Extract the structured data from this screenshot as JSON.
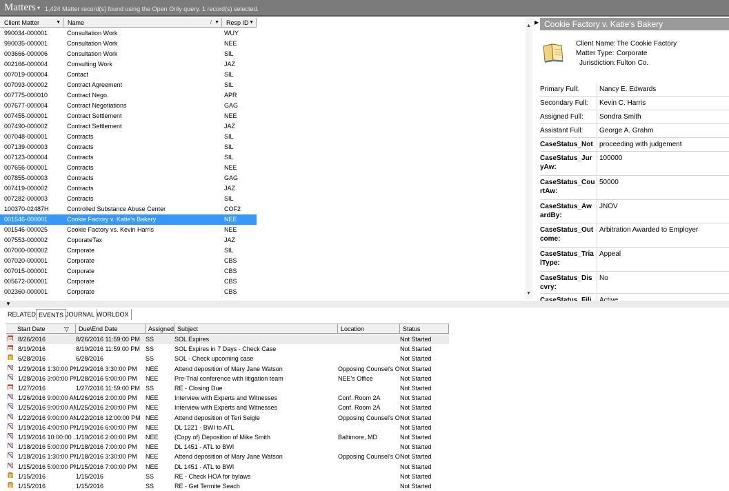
{
  "topbar": {
    "title": "Matters",
    "dropdown": "▾",
    "info": "1,424 Matter record(s) found using the Open Only query.     1 record(s) selected."
  },
  "grid": {
    "columns": [
      "Client Matter",
      "Name",
      "Resp ID"
    ],
    "rows": [
      {
        "cm": "990034-000001",
        "name": "Consultation Work",
        "resp": "WUY"
      },
      {
        "cm": "990035-000001",
        "name": "Consultation Work",
        "resp": "NEE"
      },
      {
        "cm": "003666-000006",
        "name": "Consultation Work",
        "resp": "SIL"
      },
      {
        "cm": "002166-000004",
        "name": "Consulting Work",
        "resp": "JAZ"
      },
      {
        "cm": "007019-000004",
        "name": "Contact",
        "resp": "SIL"
      },
      {
        "cm": "007093-000002",
        "name": "Contract Agreement",
        "resp": "SIL"
      },
      {
        "cm": "007775-000010",
        "name": "Contract Nego.",
        "resp": "APR"
      },
      {
        "cm": "007677-000004",
        "name": "Contract Negotiations",
        "resp": "GAG"
      },
      {
        "cm": "007455-000001",
        "name": "Contract Settlement",
        "resp": "NEE"
      },
      {
        "cm": "007490-000002",
        "name": "Contract Settlement",
        "resp": "JAZ"
      },
      {
        "cm": "007048-000001",
        "name": "Contracts",
        "resp": "SIL"
      },
      {
        "cm": "007139-000003",
        "name": "Contracts",
        "resp": "SIL"
      },
      {
        "cm": "007123-000004",
        "name": "Contracts",
        "resp": "SIL"
      },
      {
        "cm": "007656-000001",
        "name": "Contracts",
        "resp": "NEE"
      },
      {
        "cm": "007855-000003",
        "name": "Contracts",
        "resp": "GAG"
      },
      {
        "cm": "007419-000002",
        "name": "Contracts",
        "resp": "JAZ"
      },
      {
        "cm": "007282-000003",
        "name": "Contracts",
        "resp": "SIL"
      },
      {
        "cm": "100370-02487H",
        "name": "Controlled Substance Abuse Center",
        "resp": "COF2"
      },
      {
        "cm": "001546-000001",
        "name": "Cookie Factory v. Katie's Bakery",
        "resp": "NEE",
        "selected": true
      },
      {
        "cm": "001546-000025",
        "name": "Cookie Factory vs. Kevin Harris",
        "resp": "NEE"
      },
      {
        "cm": "007553-000002",
        "name": "CoporateTax",
        "resp": "JAZ"
      },
      {
        "cm": "007000-000002",
        "name": "Corporate",
        "resp": "SIL"
      },
      {
        "cm": "007020-000001",
        "name": "Corporate",
        "resp": "CBS"
      },
      {
        "cm": "007015-000001",
        "name": "Corporate",
        "resp": "CBS"
      },
      {
        "cm": "005672-000001",
        "name": "Corporate",
        "resp": "CBS"
      },
      {
        "cm": "002360-000001",
        "name": "Corporate",
        "resp": "CBS"
      }
    ]
  },
  "detail": {
    "header": "Cookie Factory v. Katie's Bakery",
    "client_name_label": "Client Name:",
    "client_name": "The Cookie Factory",
    "matter_type_label": "Matter Type:",
    "matter_type": "Corporate",
    "jurisdiction_label": "Jurisdiction:",
    "jurisdiction": "Fulton Co.",
    "fields": [
      {
        "l1": "Primary Full:",
        "l2": "",
        "value": "Nancy E. Edwards",
        "bold": false
      },
      {
        "l1": "Secondary Full:",
        "l2": "",
        "value": "Kevin C. Harris",
        "bold": false
      },
      {
        "l1": "Assigned Full:",
        "l2": "",
        "value": "Sondra Smith",
        "bold": false
      },
      {
        "l1": "Assistant Full:",
        "l2": "",
        "value": "George A. Grahm",
        "bold": false
      },
      {
        "l1": "CaseStatus_Not",
        "l2": "",
        "value": "proceeding with judgement",
        "bold": true
      },
      {
        "l1": "CaseStatus_Jur",
        "l2": "yAw:",
        "value": "100000",
        "bold": true
      },
      {
        "l1": "CaseStatus_Cou",
        "l2": "rtAw:",
        "value": "50000",
        "bold": true
      },
      {
        "l1": "CaseStatus_Aw",
        "l2": "ardBy:",
        "value": "JNOV",
        "bold": true
      },
      {
        "l1": "CaseStatus_Out",
        "l2": "come:",
        "value": "Arbitration Awarded to Employer",
        "bold": true
      },
      {
        "l1": "CaseStatus_Tria",
        "l2": "lType:",
        "value": "Appeal",
        "bold": true
      },
      {
        "l1": "CaseStatus_Dis",
        "l2": "cvry:",
        "value": "No",
        "bold": true
      },
      {
        "l1": "CaseStatus_Fili",
        "l2": "",
        "value": "Active",
        "bold": true
      }
    ]
  },
  "tabs": [
    "RELATED",
    "EVENTS",
    "JOURNAL",
    "WORLDOX"
  ],
  "events": {
    "columns": [
      "Start Date",
      "Due\\End Date",
      "Assigned...",
      "Subject",
      "Location",
      "Status"
    ],
    "rows": [
      {
        "icon": "cal",
        "start": "8/26/2016",
        "end": "8/26/2016 11:59:00 PM",
        "asg": "SS",
        "subj": "SOL Expires",
        "loc": "",
        "status": "Not Started"
      },
      {
        "icon": "cal",
        "start": "8/19/2016",
        "end": "8/19/2016 11:59:00 PM",
        "asg": "SS",
        "subj": "SOL Expires in 7 Days - Check Case",
        "loc": "",
        "status": "Not Started"
      },
      {
        "icon": "task",
        "start": "6/28/2016",
        "end": "6/28/2016",
        "asg": "SS",
        "subj": "SOL - Check upcoming case",
        "loc": "",
        "status": "Not Started"
      },
      {
        "icon": "event",
        "start": "1/29/2016 1:30:00 PM",
        "end": "1/29/2016 3:30:00 PM",
        "asg": "NEE",
        "subj": "Attend deposition of Mary Jane Watson",
        "loc": "Opposing Counsel's Offi...",
        "status": "Not Started"
      },
      {
        "icon": "event",
        "start": "1/28/2016 3:00:00 PM",
        "end": "1/28/2016 5:00:00 PM",
        "asg": "NEE",
        "subj": "Pre-Trial conference with litigation team",
        "loc": "NEE's Office",
        "status": "Not Started"
      },
      {
        "icon": "cal",
        "start": "1/27/2016",
        "end": "1/27/2016 11:59:00 PM",
        "asg": "SS",
        "subj": "RE - Closing Due",
        "loc": "",
        "status": "Not Started"
      },
      {
        "icon": "event",
        "start": "1/26/2016 9:00:00 AM",
        "end": "1/26/2016 2:00:00 PM",
        "asg": "NEE",
        "subj": "Interview with Experts and Witnesses",
        "loc": "Conf. Room 2A",
        "status": "Not Started"
      },
      {
        "icon": "event",
        "start": "1/25/2016 9:00:00 AM",
        "end": "1/25/2016 2:00:00 PM",
        "asg": "NEE",
        "subj": "Interview with Experts and Witnesses",
        "loc": "Conf. Room 2A",
        "status": "Not Started"
      },
      {
        "icon": "event",
        "start": "1/22/2016 9:00:00 AM",
        "end": "1/22/2016 12:00:00 PM",
        "asg": "NEE",
        "subj": "Attend deposition of Teri Seigle",
        "loc": "Opposing Counsel's Offi...",
        "status": "Not Started"
      },
      {
        "icon": "event",
        "start": "1/19/2016 4:00:00 PM",
        "end": "1/19/2016 6:00:00 PM",
        "asg": "NEE",
        "subj": "DL 1221 - BWI to ATL",
        "loc": "",
        "status": "Not Started"
      },
      {
        "icon": "event",
        "start": "1/19/2016 10:00:00 ...",
        "end": "1/19/2016 2:00:00 PM",
        "asg": "NEE",
        "subj": "(Copy of) Deposition of Mike Smith",
        "loc": "Baltimore, MD",
        "status": "Not Started"
      },
      {
        "icon": "event",
        "start": "1/18/2016 5:00:00 PM",
        "end": "1/18/2016 7:00:00 PM",
        "asg": "NEE",
        "subj": "DL 1451 - ATL to BWI",
        "loc": "",
        "status": "Not Started"
      },
      {
        "icon": "event",
        "start": "1/18/2016 1:30:00 PM",
        "end": "1/18/2016 3:30:00 PM",
        "asg": "NEE",
        "subj": "Attend deposition of Mary Jane Watson",
        "loc": "Opposing Counsel's Offi...",
        "status": "Not Started"
      },
      {
        "icon": "event",
        "start": "1/15/2016 5:00:00 PM",
        "end": "1/15/2016 7:00:00 PM",
        "asg": "NEE",
        "subj": "DL 1451 - ATL to BWI",
        "loc": "",
        "status": "Not Started"
      },
      {
        "icon": "task",
        "start": "1/15/2016",
        "end": "1/15/2016",
        "asg": "SS",
        "subj": "RE - Check HOA for bylaws",
        "loc": "",
        "status": "Not Started"
      },
      {
        "icon": "task",
        "start": "1/15/2016",
        "end": "1/15/2016",
        "asg": "SS",
        "subj": "RE - Get Termite Seach",
        "loc": "",
        "status": "Not Started"
      }
    ]
  },
  "colors": {
    "selection": "#3399ff",
    "header_bar": "#7b7b7b",
    "detail_header": "#9a9a9a"
  }
}
